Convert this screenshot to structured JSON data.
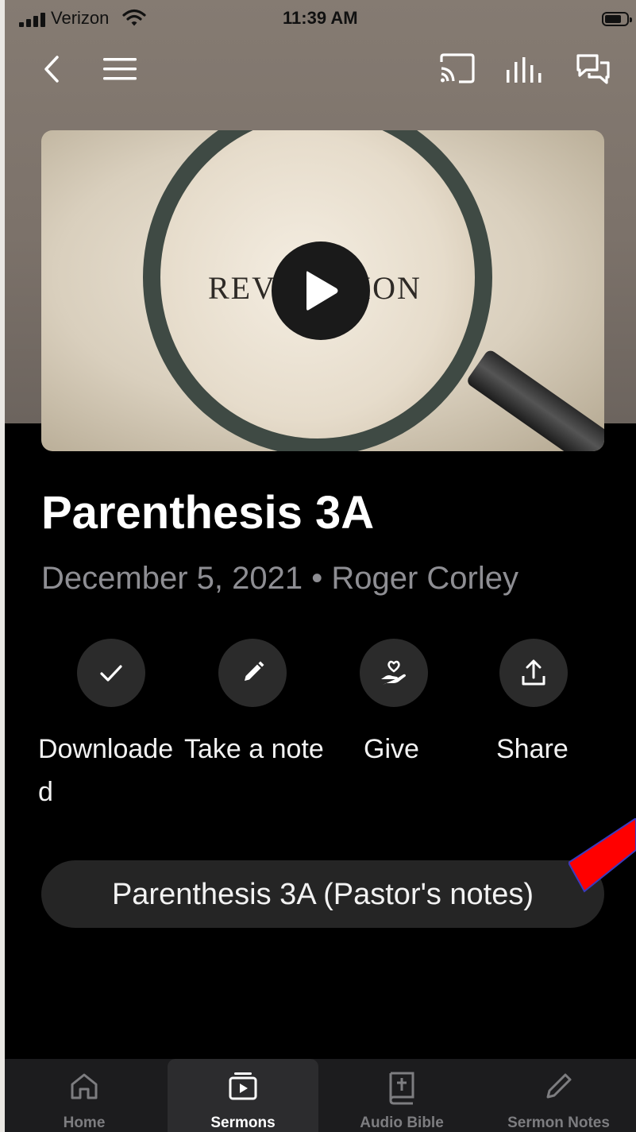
{
  "status_bar": {
    "carrier": "Verizon",
    "time": "11:39 AM"
  },
  "nav": {
    "icons": [
      "back-chevron-icon",
      "menu-icon",
      "cast-icon",
      "audio-levels-icon",
      "chat-icon"
    ]
  },
  "artwork": {
    "text": "REVELATION"
  },
  "sermon": {
    "title": "Parenthesis 3A",
    "date": "December 5, 2021",
    "separator": "•",
    "speaker": "Roger Corley"
  },
  "actions": [
    {
      "label": "Downloaded",
      "label_line1": "Downloade",
      "label_line2": "d",
      "icon": "checkmark-icon"
    },
    {
      "label": "Take a note",
      "icon": "pencil-icon"
    },
    {
      "label": "Give",
      "icon": "heart-hand-icon"
    },
    {
      "label": "Share",
      "icon": "share-upload-icon"
    }
  ],
  "notes_button": {
    "label": "Parenthesis 3A (Pastor's notes)"
  },
  "annotation": {
    "color": "#ff0000"
  },
  "tab_bar": {
    "tabs": [
      {
        "label": "Home",
        "icon": "home-icon",
        "active": false
      },
      {
        "label": "Sermons",
        "icon": "sermons-play-icon",
        "active": true
      },
      {
        "label": "Audio Bible",
        "icon": "bible-icon",
        "active": false
      },
      {
        "label": "Sermon Notes",
        "icon": "pencil-icon",
        "active": false
      }
    ]
  },
  "colors": {
    "background": "#000000",
    "header_band": "#7c726a",
    "action_circle": "#2b2b2b",
    "muted_text": "#8e8e93",
    "tab_bar": "#1c1c1e"
  }
}
